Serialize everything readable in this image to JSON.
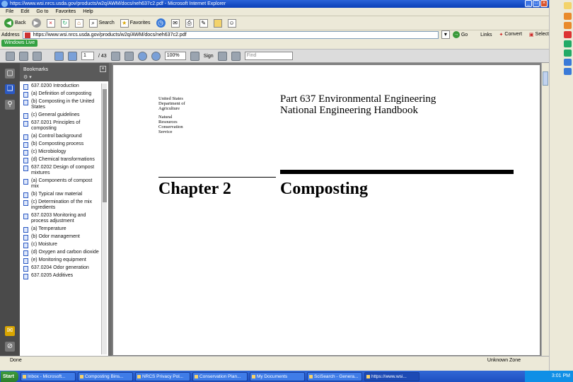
{
  "window": {
    "title": "https://www.wsi.nrcs.usda.gov/products/w2q/AWM/docs/neh637c2.pdf - Microsoft Internet Explorer"
  },
  "menu": [
    "File",
    "Edit",
    "Go to",
    "Favorites",
    "Help"
  ],
  "ie_toolbar": {
    "back": "Back",
    "search": "Search",
    "favorites": "Favorites"
  },
  "address": {
    "label": "Address",
    "url": "https://www.wsi.nrcs.usda.gov/products/w2q/AWM/docs/neh637c2.pdf",
    "go": "Go",
    "links": "Links",
    "convert": "Convert",
    "select": "Select"
  },
  "links_bar": {
    "chip": "Windows Live"
  },
  "pdf_toolbar": {
    "page_current": "1",
    "page_total": "/ 43",
    "zoom": "100%",
    "sign": "Sign",
    "find_placeholder": "Find"
  },
  "bookmarks": {
    "title": "Bookmarks",
    "options": "⚙ ▾",
    "items": [
      "637.0200 Introduction",
      "(a) Definition of composting",
      "(b) Composting in the United States",
      "(c) General guidelines",
      "637.0201 Principles of composting",
      "(a) Control background",
      "(b) Composting process",
      "(c) Microbiology",
      "(d) Chemical transformations",
      "637.0202 Design of compost mixtures",
      "(a) Components of compost mix",
      "(b) Typical raw material",
      "(c) Determination of the mix ingredients",
      "637.0203 Monitoring and process adjustment",
      "(a) Temperature",
      "(b) Odor management",
      "(c) Moisture",
      "(d) Oxygen and carbon dioxide",
      "(e) Monitoring equipment",
      "637.0204 Odor generation",
      "637.0205 Additives"
    ]
  },
  "document": {
    "agency_lines": [
      "United States",
      "Department of",
      "Agriculture",
      "",
      "Natural",
      "Resources",
      "Conservation",
      "Service"
    ],
    "part_title_line1": "Part 637 Environmental Engineering",
    "part_title_line2": "National Engineering Handbook",
    "chapter_label": "Chapter 2",
    "chapter_title": "Composting"
  },
  "status": {
    "left": "Done",
    "zone": "Unknown Zone"
  },
  "taskbar": {
    "start": "Start",
    "tasks": [
      "Inbox - Microsoft...",
      "Composting Bins...",
      "NRCS Privacy Pol...",
      "Conservation Plan...",
      "My Documents",
      "SciSearch - Genera...",
      "https://www.wsi..."
    ],
    "active_index": 6,
    "clock": "3:01 PM"
  }
}
